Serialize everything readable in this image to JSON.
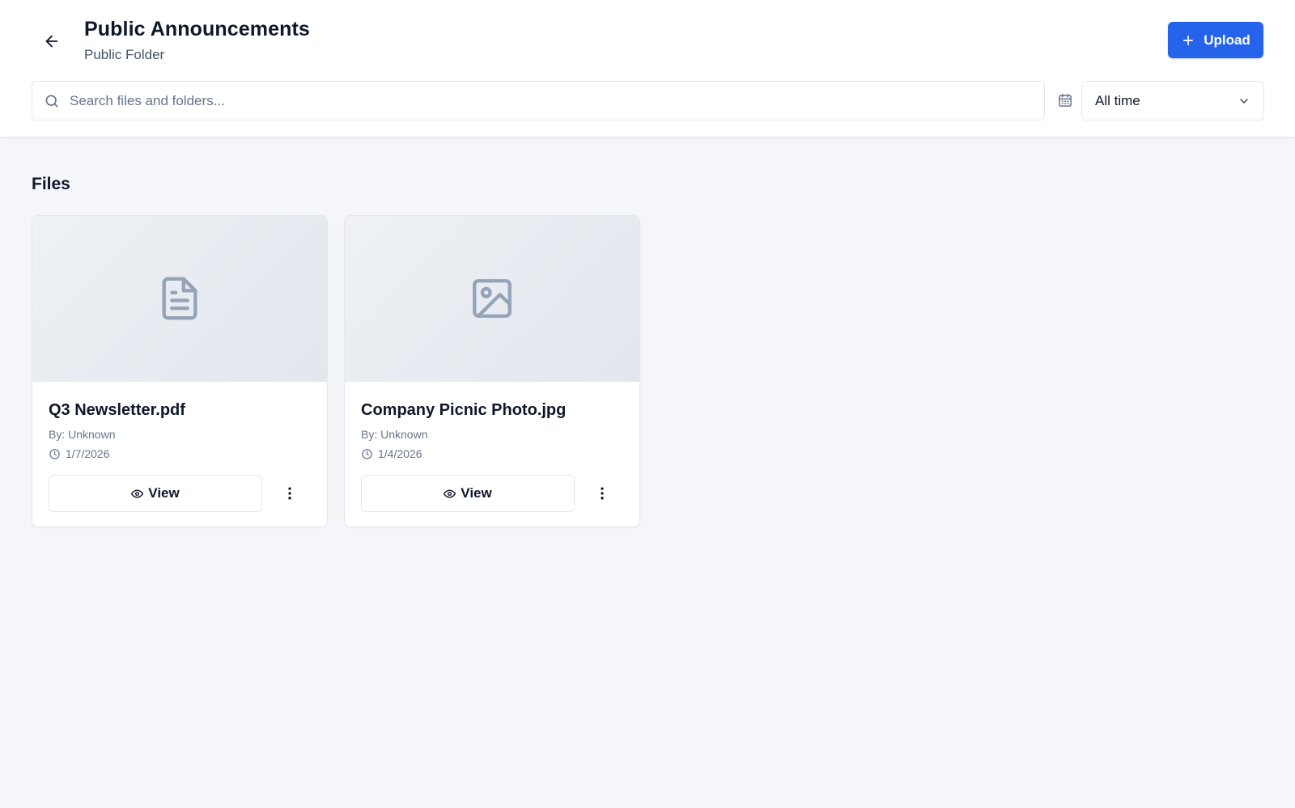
{
  "header": {
    "title": "Public Announcements",
    "subtitle": "Public Folder",
    "back_icon": "arrow-left-icon",
    "upload_label": "Upload"
  },
  "search": {
    "placeholder": "Search files and folders...",
    "value": ""
  },
  "filter": {
    "selected": "All time"
  },
  "files_section": {
    "title": "Files",
    "items": [
      {
        "name": "Q3 Newsletter.pdf",
        "by": "By: Unknown",
        "date": "1/7/2026",
        "icon": "file-text-icon",
        "view_label": "View"
      },
      {
        "name": "Company Picnic Photo.jpg",
        "by": "By: Unknown",
        "date": "1/4/2026",
        "icon": "image-icon",
        "view_label": "View"
      }
    ]
  },
  "colors": {
    "accent": "#2563eb",
    "thumbnail_icon": "#94a3b8",
    "text_primary": "#0f172a",
    "text_muted": "#64748b"
  }
}
